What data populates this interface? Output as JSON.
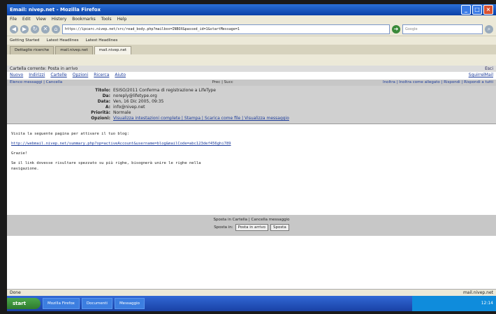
{
  "browser": {
    "title": "Email: nivep.net - Mozilla Firefox",
    "menu": [
      "File",
      "Edit",
      "View",
      "History",
      "Bookmarks",
      "Tools",
      "Help"
    ],
    "url": "https://ipcarc.nivep.net/src/read_body.php?mailbox=INBOX&passed_id=1&startMessage=1",
    "search_placeholder": "Google",
    "bookmarks": [
      "Getting Started",
      "Latest Headlines",
      "Latest Headlines"
    ],
    "tabs": [
      {
        "label": "Dettaglio ricerche",
        "active": false
      },
      {
        "label": "mail.nivep.net",
        "active": false
      },
      {
        "label": "mail.nivep.net",
        "active": true
      }
    ]
  },
  "webmail": {
    "folder_label": "Cartella corrente: Posta in arrivo",
    "signout": "Esci",
    "links": [
      "Nuovo",
      "Indirizzi",
      "Cartelle",
      "Opzioni",
      "Ricerca",
      "Aiuto"
    ],
    "brand": "SquirrelMail",
    "toolbar_left": "Elenco messaggi | Cancella",
    "toolbar_mid": "Prec | Succ",
    "toolbar_right": "Inoltra | Inoltra come allegato | Rispondi | Rispondi a tutti",
    "headers": [
      {
        "key": "Titolo:",
        "value": "ESISO/2011 Conferma di registrazione a LifeType",
        "link": false
      },
      {
        "key": "Da:",
        "value": "noreply@lifetype.org",
        "link": false
      },
      {
        "key": "Data:",
        "value": "Ven, 16 Dic 2005, 09:35",
        "link": false
      },
      {
        "key": "A:",
        "value": "info@nivep.net",
        "link": false
      },
      {
        "key": "Priorità:",
        "value": "Normale",
        "link": false
      },
      {
        "key": "Opzioni:",
        "value": "Visualizza intestazioni complete | Stampa | Scarica come file | Visualizza messaggio",
        "link": true
      }
    ],
    "body_lines": [
      "Visita la seguente pagina per attivare il tuo blog:",
      "http://webmail.nivep.net/summary.php?op=activeAccount&username=blog&mailCode=abc123def456ghi789",
      "Grazie!",
      "Se il link dovesse risultare spezzato su più righe, bisognerà unire le righe nella",
      "navigazione."
    ],
    "footer_title": "Sposta in Cartella | Cancella messaggio",
    "move_label": "Sposta in:",
    "move_select": "Posta in arrivo",
    "move_button": "Sposta"
  },
  "status": {
    "left": "Done",
    "right": "mail.nivep.net"
  },
  "taskbar": {
    "start": "start",
    "items": [
      "Mozilla Firefox",
      "Documenti",
      "Messaggio"
    ],
    "tray": "12:14"
  }
}
